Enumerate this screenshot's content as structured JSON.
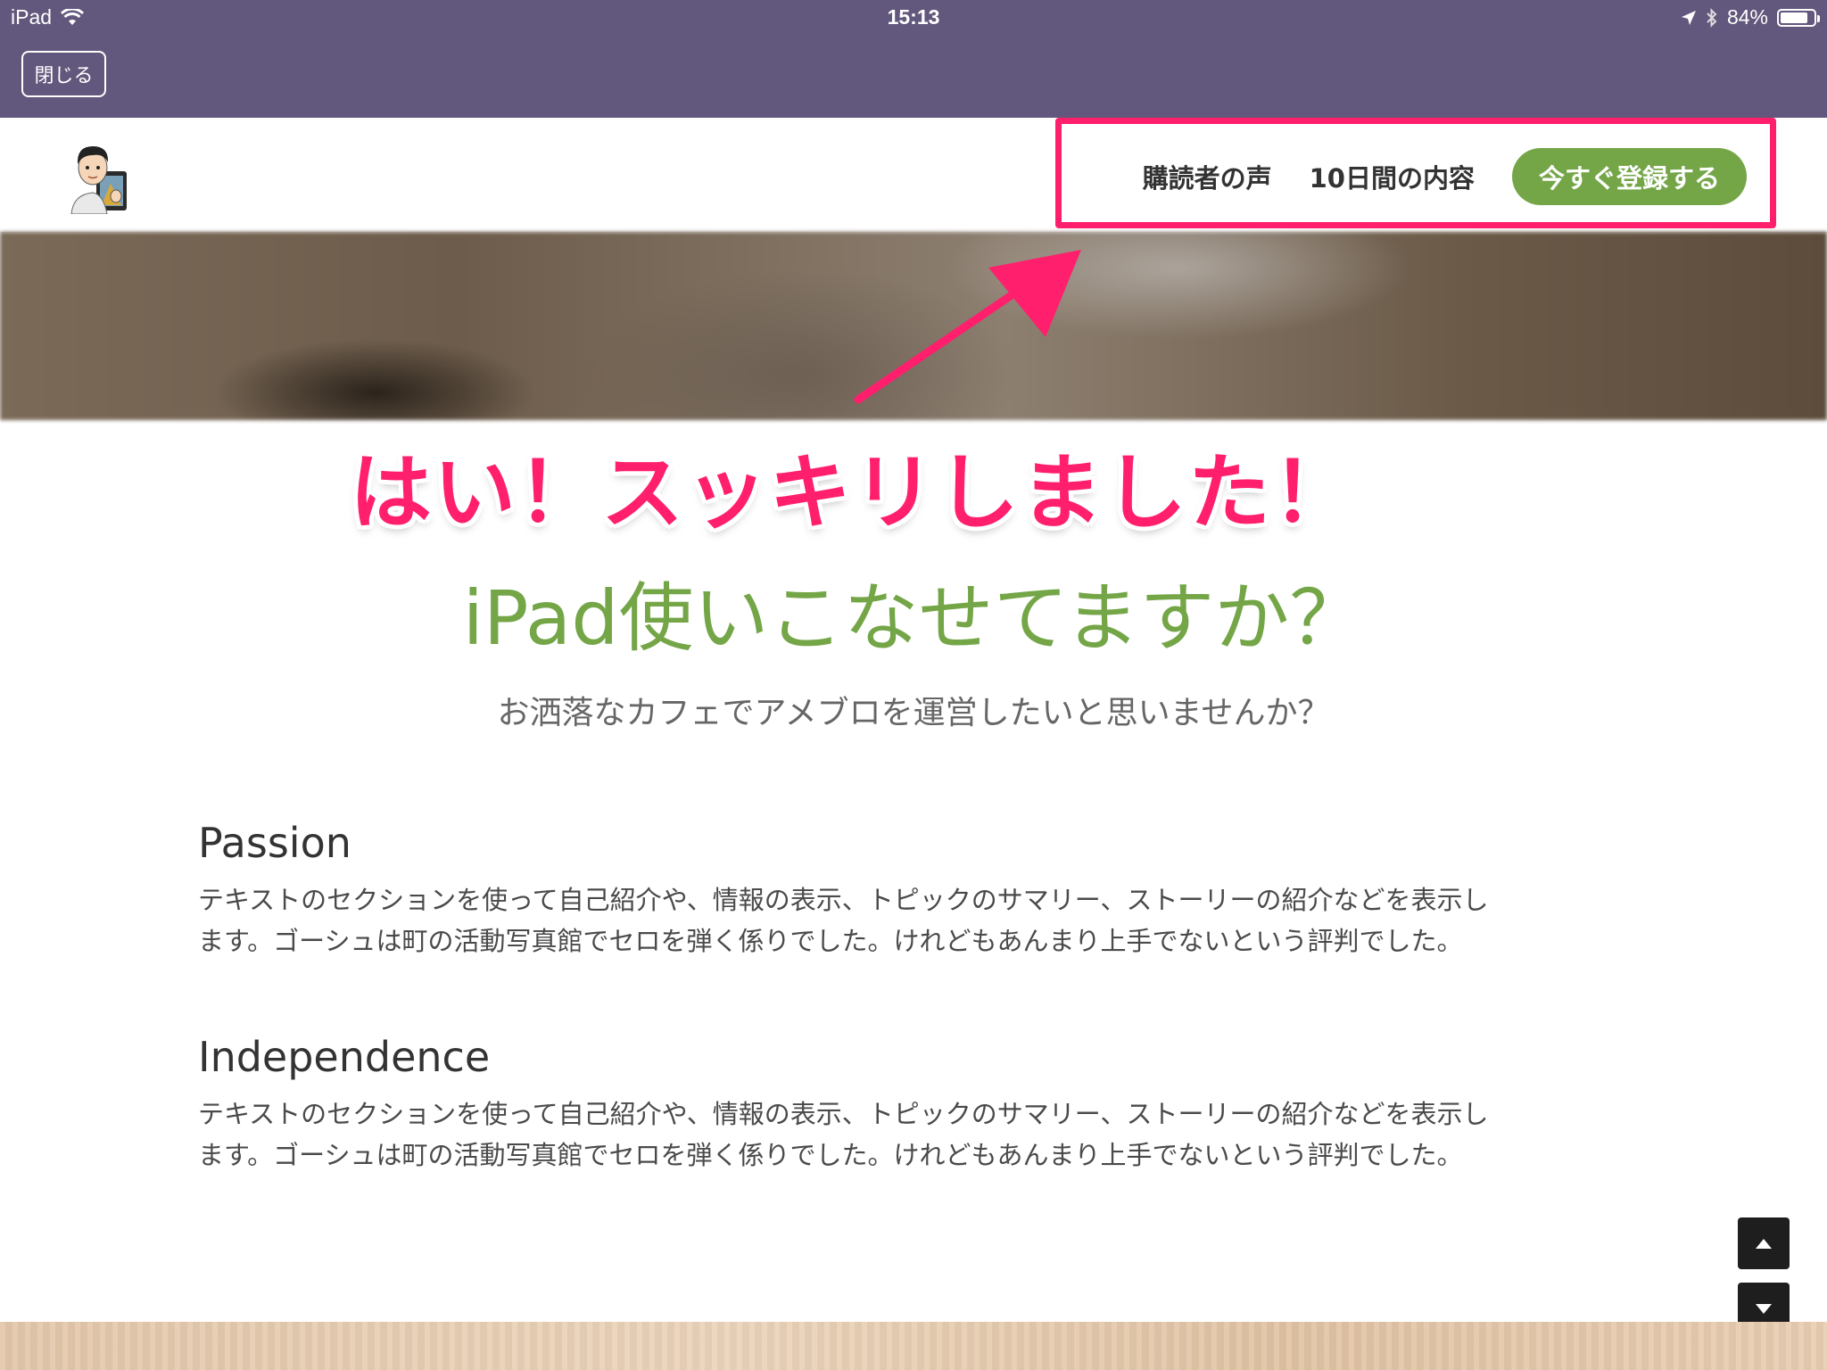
{
  "status_bar": {
    "device": "iPad",
    "time": "15:13",
    "battery": "84%",
    "battery_level": 0.84
  },
  "app_bar": {
    "close_label": "閉じる"
  },
  "header": {
    "nav": [
      {
        "label": "購読者の声"
      },
      {
        "label": "10日間の内容"
      }
    ],
    "cta_label": "今すぐ登録する"
  },
  "annotation": {
    "text": "はい！スッキリしました！",
    "color": "#ff1f6d"
  },
  "main": {
    "title": "iPad使いこなせてますか？",
    "subtitle": "お洒落なカフェでアメブロを運営したいと思いませんか？",
    "sections": [
      {
        "heading": "Passion",
        "line1": "テキストのセクションを使って自己紹介や、情報の表示、トピックのサマリー、ストーリーの紹介などを表示し",
        "line2": "ます。ゴーシュは町の活動写真館でセロを弾く係りでした。けれどもあんまり上手でないという評判でした。"
      },
      {
        "heading": "Independence",
        "line1": "テキストのセクションを使って自己紹介や、情報の表示、トピックのサマリー、ストーリーの紹介などを表示し",
        "line2": "ます。ゴーシュは町の活動写真館でセロを弾く係りでした。けれどもあんまり上手でないという評判でした。"
      }
    ]
  },
  "colors": {
    "app_bar": "#62577c",
    "accent_green": "#74a648",
    "annotation_pink": "#ff1f6d"
  },
  "icons": {
    "wifi": "wifi-icon",
    "location": "location-arrow-icon",
    "bluetooth": "bluetooth-icon",
    "battery": "battery-icon",
    "scroll_up": "triangle-up-icon",
    "scroll_down": "triangle-down-icon"
  }
}
